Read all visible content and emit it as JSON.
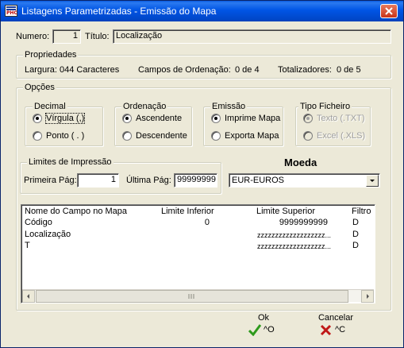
{
  "window": {
    "title": "Listagens Parametrizadas - Emissão do Mapa"
  },
  "header": {
    "numero_label": "Numero:",
    "numero_value": "1",
    "titulo_label": "Título:",
    "titulo_value": "Localização"
  },
  "propriedades": {
    "title": "Propriedades",
    "largura": "Largura: 044 Caracteres",
    "campos_ordenacao_label": "Campos de Ordenação:",
    "campos_ordenacao_value": "0 de 4",
    "totalizadores_label": "Totalizadores:",
    "totalizadores_value": "0 de 5"
  },
  "opcoes": {
    "title": "Opções",
    "decimal": {
      "title": "Decimal",
      "options": [
        "Vírgula (,)",
        "Ponto ( . )"
      ],
      "selected": 0
    },
    "ordenacao": {
      "title": "Ordenação",
      "options": [
        "Ascendente",
        "Descendente"
      ],
      "selected": 0
    },
    "emissao": {
      "title": "Emissão",
      "options": [
        "Imprime Mapa",
        "Exporta Mapa"
      ],
      "selected": 0
    },
    "tipo_ficheiro": {
      "title": "Tipo Ficheiro",
      "options": [
        "Texto (.TXT)",
        "Excel (.XLS)"
      ],
      "selected": 0,
      "disabled": true
    },
    "limites": {
      "title": "Limites de Impressão",
      "primeira_label": "Primeira Pág:",
      "primeira_value": "1",
      "ultima_label": "Última Pág:",
      "ultima_value": "99999999"
    },
    "moeda": {
      "title": "Moeda",
      "selected": "EUR-EUROS"
    }
  },
  "grid": {
    "columns": [
      "Nome do Campo no Mapa",
      "Limite Inferior",
      "Limite Superior",
      "Filtro"
    ],
    "rows": [
      {
        "nome": "Código",
        "inferior": "0",
        "superior": "9999999999",
        "filtro": "D"
      },
      {
        "nome": "Localização",
        "inferior": "",
        "superior": "zzzzzzzzzzzzzzzzzzz...",
        "filtro": "D"
      },
      {
        "nome": "T",
        "inferior": "",
        "superior": "zzzzzzzzzzzzzzzzzzz...",
        "filtro": "D"
      }
    ]
  },
  "buttons": {
    "ok_label": "Ok",
    "ok_shortcut": "^O",
    "cancel_label": "Cancelar",
    "cancel_shortcut": "^C"
  },
  "colors": {
    "titlebar": "#0055e5",
    "window_bg": "#ece9d8",
    "ok_icon": "#2e9a1c",
    "cancel_icon": "#c01818"
  }
}
